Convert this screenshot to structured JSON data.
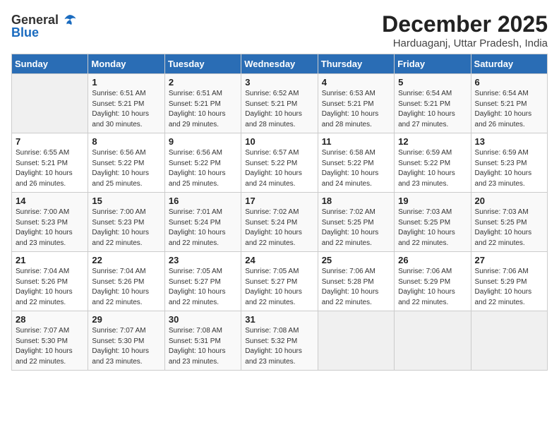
{
  "header": {
    "logo_general": "General",
    "logo_blue": "Blue",
    "month_year": "December 2025",
    "location": "Harduaganj, Uttar Pradesh, India"
  },
  "columns": [
    "Sunday",
    "Monday",
    "Tuesday",
    "Wednesday",
    "Thursday",
    "Friday",
    "Saturday"
  ],
  "weeks": [
    [
      {
        "day": "",
        "sunrise": "",
        "sunset": "",
        "daylight": ""
      },
      {
        "day": "1",
        "sunrise": "Sunrise: 6:51 AM",
        "sunset": "Sunset: 5:21 PM",
        "daylight": "Daylight: 10 hours and 30 minutes."
      },
      {
        "day": "2",
        "sunrise": "Sunrise: 6:51 AM",
        "sunset": "Sunset: 5:21 PM",
        "daylight": "Daylight: 10 hours and 29 minutes."
      },
      {
        "day": "3",
        "sunrise": "Sunrise: 6:52 AM",
        "sunset": "Sunset: 5:21 PM",
        "daylight": "Daylight: 10 hours and 28 minutes."
      },
      {
        "day": "4",
        "sunrise": "Sunrise: 6:53 AM",
        "sunset": "Sunset: 5:21 PM",
        "daylight": "Daylight: 10 hours and 28 minutes."
      },
      {
        "day": "5",
        "sunrise": "Sunrise: 6:54 AM",
        "sunset": "Sunset: 5:21 PM",
        "daylight": "Daylight: 10 hours and 27 minutes."
      },
      {
        "day": "6",
        "sunrise": "Sunrise: 6:54 AM",
        "sunset": "Sunset: 5:21 PM",
        "daylight": "Daylight: 10 hours and 26 minutes."
      }
    ],
    [
      {
        "day": "7",
        "sunrise": "Sunrise: 6:55 AM",
        "sunset": "Sunset: 5:21 PM",
        "daylight": "Daylight: 10 hours and 26 minutes."
      },
      {
        "day": "8",
        "sunrise": "Sunrise: 6:56 AM",
        "sunset": "Sunset: 5:22 PM",
        "daylight": "Daylight: 10 hours and 25 minutes."
      },
      {
        "day": "9",
        "sunrise": "Sunrise: 6:56 AM",
        "sunset": "Sunset: 5:22 PM",
        "daylight": "Daylight: 10 hours and 25 minutes."
      },
      {
        "day": "10",
        "sunrise": "Sunrise: 6:57 AM",
        "sunset": "Sunset: 5:22 PM",
        "daylight": "Daylight: 10 hours and 24 minutes."
      },
      {
        "day": "11",
        "sunrise": "Sunrise: 6:58 AM",
        "sunset": "Sunset: 5:22 PM",
        "daylight": "Daylight: 10 hours and 24 minutes."
      },
      {
        "day": "12",
        "sunrise": "Sunrise: 6:59 AM",
        "sunset": "Sunset: 5:22 PM",
        "daylight": "Daylight: 10 hours and 23 minutes."
      },
      {
        "day": "13",
        "sunrise": "Sunrise: 6:59 AM",
        "sunset": "Sunset: 5:23 PM",
        "daylight": "Daylight: 10 hours and 23 minutes."
      }
    ],
    [
      {
        "day": "14",
        "sunrise": "Sunrise: 7:00 AM",
        "sunset": "Sunset: 5:23 PM",
        "daylight": "Daylight: 10 hours and 23 minutes."
      },
      {
        "day": "15",
        "sunrise": "Sunrise: 7:00 AM",
        "sunset": "Sunset: 5:23 PM",
        "daylight": "Daylight: 10 hours and 22 minutes."
      },
      {
        "day": "16",
        "sunrise": "Sunrise: 7:01 AM",
        "sunset": "Sunset: 5:24 PM",
        "daylight": "Daylight: 10 hours and 22 minutes."
      },
      {
        "day": "17",
        "sunrise": "Sunrise: 7:02 AM",
        "sunset": "Sunset: 5:24 PM",
        "daylight": "Daylight: 10 hours and 22 minutes."
      },
      {
        "day": "18",
        "sunrise": "Sunrise: 7:02 AM",
        "sunset": "Sunset: 5:25 PM",
        "daylight": "Daylight: 10 hours and 22 minutes."
      },
      {
        "day": "19",
        "sunrise": "Sunrise: 7:03 AM",
        "sunset": "Sunset: 5:25 PM",
        "daylight": "Daylight: 10 hours and 22 minutes."
      },
      {
        "day": "20",
        "sunrise": "Sunrise: 7:03 AM",
        "sunset": "Sunset: 5:25 PM",
        "daylight": "Daylight: 10 hours and 22 minutes."
      }
    ],
    [
      {
        "day": "21",
        "sunrise": "Sunrise: 7:04 AM",
        "sunset": "Sunset: 5:26 PM",
        "daylight": "Daylight: 10 hours and 22 minutes."
      },
      {
        "day": "22",
        "sunrise": "Sunrise: 7:04 AM",
        "sunset": "Sunset: 5:26 PM",
        "daylight": "Daylight: 10 hours and 22 minutes."
      },
      {
        "day": "23",
        "sunrise": "Sunrise: 7:05 AM",
        "sunset": "Sunset: 5:27 PM",
        "daylight": "Daylight: 10 hours and 22 minutes."
      },
      {
        "day": "24",
        "sunrise": "Sunrise: 7:05 AM",
        "sunset": "Sunset: 5:27 PM",
        "daylight": "Daylight: 10 hours and 22 minutes."
      },
      {
        "day": "25",
        "sunrise": "Sunrise: 7:06 AM",
        "sunset": "Sunset: 5:28 PM",
        "daylight": "Daylight: 10 hours and 22 minutes."
      },
      {
        "day": "26",
        "sunrise": "Sunrise: 7:06 AM",
        "sunset": "Sunset: 5:29 PM",
        "daylight": "Daylight: 10 hours and 22 minutes."
      },
      {
        "day": "27",
        "sunrise": "Sunrise: 7:06 AM",
        "sunset": "Sunset: 5:29 PM",
        "daylight": "Daylight: 10 hours and 22 minutes."
      }
    ],
    [
      {
        "day": "28",
        "sunrise": "Sunrise: 7:07 AM",
        "sunset": "Sunset: 5:30 PM",
        "daylight": "Daylight: 10 hours and 22 minutes."
      },
      {
        "day": "29",
        "sunrise": "Sunrise: 7:07 AM",
        "sunset": "Sunset: 5:30 PM",
        "daylight": "Daylight: 10 hours and 23 minutes."
      },
      {
        "day": "30",
        "sunrise": "Sunrise: 7:08 AM",
        "sunset": "Sunset: 5:31 PM",
        "daylight": "Daylight: 10 hours and 23 minutes."
      },
      {
        "day": "31",
        "sunrise": "Sunrise: 7:08 AM",
        "sunset": "Sunset: 5:32 PM",
        "daylight": "Daylight: 10 hours and 23 minutes."
      },
      {
        "day": "",
        "sunrise": "",
        "sunset": "",
        "daylight": ""
      },
      {
        "day": "",
        "sunrise": "",
        "sunset": "",
        "daylight": ""
      },
      {
        "day": "",
        "sunrise": "",
        "sunset": "",
        "daylight": ""
      }
    ]
  ]
}
